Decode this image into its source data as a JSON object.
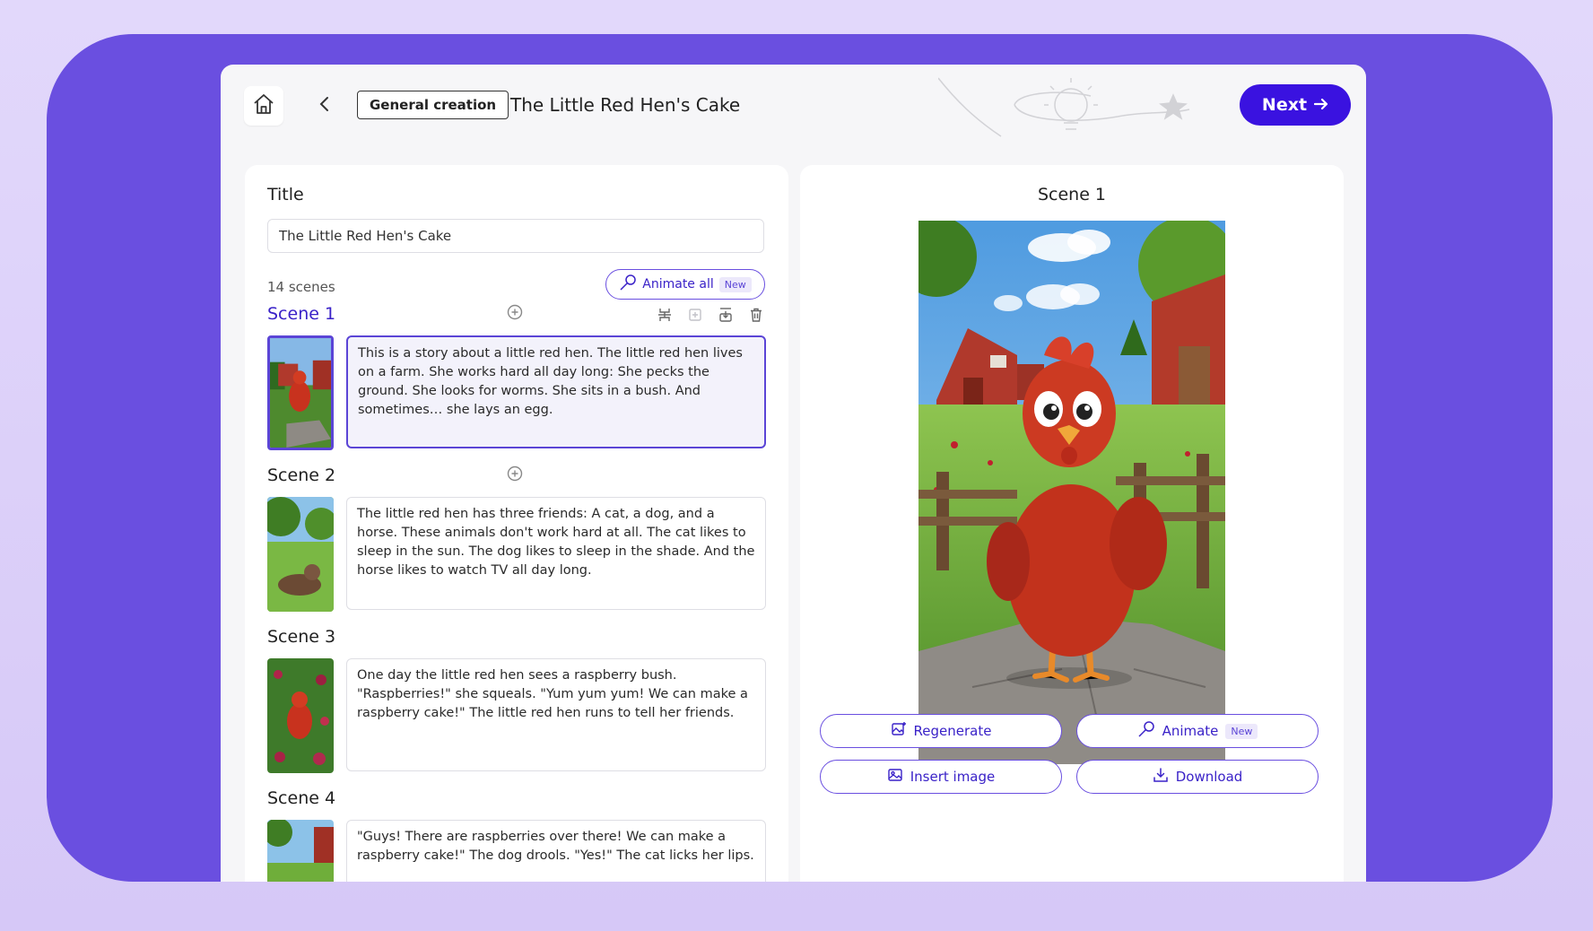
{
  "header": {
    "badge": "General creation",
    "title": "The Little Red Hen's Cake",
    "next_label": "Next"
  },
  "editor": {
    "title_label": "Title",
    "title_value": "The Little Red Hen's Cake",
    "scene_count": "14 scenes",
    "animate_all_label": "Animate all",
    "new_tag": "New",
    "scenes": [
      {
        "label": "Scene 1",
        "text": "This is a story about a little red hen. The little red hen lives on a farm. She works hard all day long: She pecks the ground. She looks for worms. She sits in a bush. And sometimes… she lays an egg."
      },
      {
        "label": "Scene 2",
        "text": "The little red hen has three friends: A cat, a dog, and a horse. These animals don't work hard at all. The cat likes to sleep in the sun. The dog likes to sleep in the shade. And the horse likes to watch TV all day long."
      },
      {
        "label": "Scene 3",
        "text": "One day the little red hen sees a raspberry bush. \"Raspberries!\" she squeals. \"Yum yum yum! We can make a raspberry cake!\" The little red hen runs to tell her friends."
      },
      {
        "label": "Scene 4",
        "text": "\"Guys! There are raspberries over there! We can make a raspberry cake!\" The dog drools. \"Yes!\" The cat licks her lips."
      }
    ]
  },
  "preview": {
    "title": "Scene 1",
    "regenerate_label": "Regenerate",
    "animate_label": "Animate",
    "new_tag": "New",
    "insert_label": "Insert image",
    "download_label": "Download"
  },
  "colors": {
    "accent": "#3a12e0",
    "frame": "#6a4fe0",
    "background": "#ddd0f9"
  }
}
